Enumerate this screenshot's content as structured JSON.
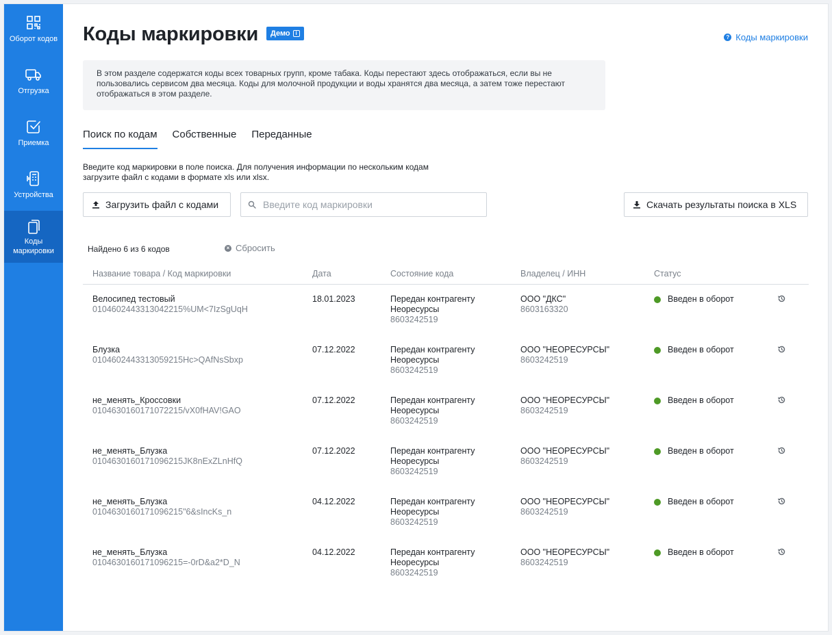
{
  "sidebar": {
    "items": [
      {
        "label": "Оборот кодов",
        "icon": "qr-code-icon"
      },
      {
        "label": "Отгрузка",
        "icon": "truck-icon"
      },
      {
        "label": "Приемка",
        "icon": "checkbox-icon"
      },
      {
        "label": "Устройства",
        "icon": "scanner-device-icon"
      },
      {
        "label": "Коды маркировки",
        "icon": "copy-documents-icon",
        "active": true
      }
    ]
  },
  "header": {
    "title": "Коды маркировки",
    "badge": "Демо",
    "help_link": "Коды маркировки"
  },
  "info_text": "В этом разделе содержатся коды всех товарных групп, кроме табака. Коды перестают здесь отображаться, если вы не пользовались сервисом два месяца. Коды для молочной продукции и воды хранятся два месяца, а затем тоже перестают отображаться в этом разделе.",
  "tabs": [
    {
      "label": "Поиск по кодам",
      "active": true
    },
    {
      "label": "Собственные"
    },
    {
      "label": "Переданные"
    }
  ],
  "hint": "Введите код маркировки в поле поиска. Для получения информации по нескольким кодам загрузите файл с кодами в формате xls или xlsx.",
  "toolbar": {
    "upload_label": "Загрузить файл с кодами",
    "search_placeholder": "Введите код маркировки",
    "download_label": "Скачать результаты поиска в XLS"
  },
  "results": {
    "found": "Найдено 6 из 6 кодов",
    "reset": "Сбросить"
  },
  "table": {
    "columns": [
      "Название товара / Код маркировки",
      "Дата",
      "Состояние кода",
      "Владелец / ИНН",
      "Статус"
    ],
    "rows": [
      {
        "name": "Велосипед тестовый",
        "code": "0104602443313042215%UM<7IzSgUqH",
        "date": "18.01.2023",
        "state": "Передан контрагенту",
        "state_to": "Неоресурсы",
        "state_inn": "8603242519",
        "owner": "ООО \"ДКС\"",
        "owner_inn": "8603163320",
        "status": "Введен в оборот"
      },
      {
        "name": "Блузка",
        "code": "0104602443313059215Hc>QAfNsSbxp",
        "date": "07.12.2022",
        "state": "Передан контрагенту",
        "state_to": "Неоресурсы",
        "state_inn": "8603242519",
        "owner": "ООО \"НЕОРЕСУРСЫ\"",
        "owner_inn": "8603242519",
        "status": "Введен в оборот"
      },
      {
        "name": "не_менять_Кроссовки",
        "code": "0104630160171072215/vX0fHAV!GAO",
        "date": "07.12.2022",
        "state": "Передан контрагенту",
        "state_to": "Неоресурсы",
        "state_inn": "8603242519",
        "owner": "ООО \"НЕОРЕСУРСЫ\"",
        "owner_inn": "8603242519",
        "status": "Введен в оборот"
      },
      {
        "name": "не_менять_Блузка",
        "code": "0104630160171096215JK8nExZLnHfQ",
        "date": "07.12.2022",
        "state": "Передан контрагенту",
        "state_to": "Неоресурсы",
        "state_inn": "8603242519",
        "owner": "ООО \"НЕОРЕСУРСЫ\"",
        "owner_inn": "8603242519",
        "status": "Введен в оборот"
      },
      {
        "name": "не_менять_Блузка",
        "code": "0104630160171096215\"6&sIncKs_n",
        "date": "04.12.2022",
        "state": "Передан контрагенту",
        "state_to": "Неоресурсы",
        "state_inn": "8603242519",
        "owner": "ООО \"НЕОРЕСУРСЫ\"",
        "owner_inn": "8603242519",
        "status": "Введен в оборот"
      },
      {
        "name": "не_менять_Блузка",
        "code": "0104630160171096215=-0rD&a2*D_N",
        "date": "04.12.2022",
        "state": "Передан контрагенту",
        "state_to": "Неоресурсы",
        "state_inn": "8603242519",
        "owner": "ООО \"НЕОРЕСУРСЫ\"",
        "owner_inn": "8603242519",
        "status": "Введен в оборот"
      }
    ]
  },
  "colors": {
    "accent": "#1f7fe3",
    "sidebar_active": "#1566c2",
    "status_ok": "#4e9a26"
  }
}
